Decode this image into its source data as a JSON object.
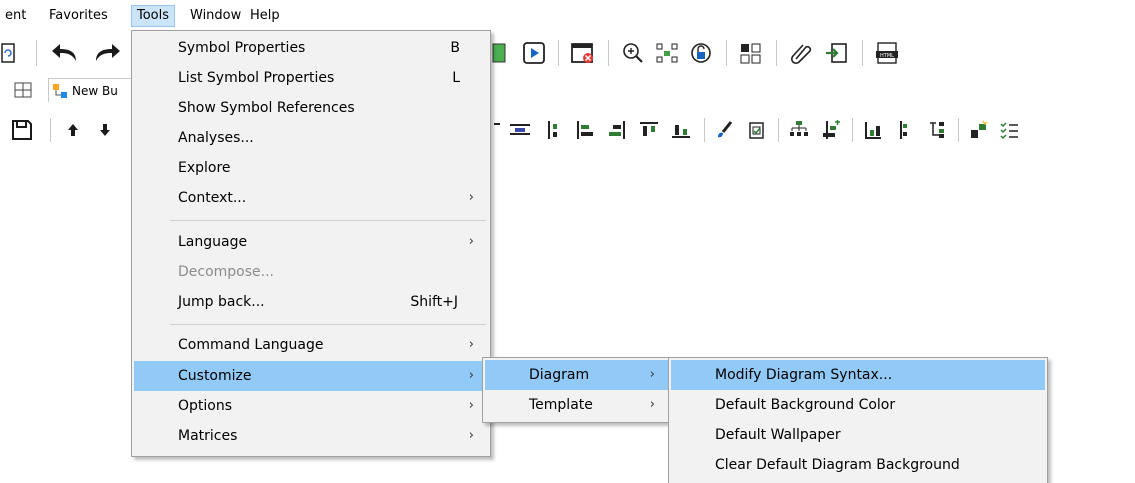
{
  "menubar": {
    "items": [
      {
        "label": "ent"
      },
      {
        "label": "Favorites"
      },
      {
        "label": "Tools"
      },
      {
        "label": "Window"
      },
      {
        "label": "Help"
      }
    ]
  },
  "tab": {
    "label": "New Bu"
  },
  "tools_menu": {
    "items": [
      {
        "label": "Symbol Properties",
        "shortcut": "B"
      },
      {
        "label": "List Symbol Properties",
        "shortcut": "L"
      },
      {
        "label": "Show Symbol References"
      },
      {
        "label": "Analyses..."
      },
      {
        "label": "Explore"
      },
      {
        "label": "Context...",
        "arrow": "›"
      },
      {
        "label": "Language",
        "arrow": "›"
      },
      {
        "label": "Decompose..."
      },
      {
        "label": "Jump back...",
        "shortcut": "Shift+J"
      },
      {
        "label": "Command Language",
        "arrow": "›"
      },
      {
        "label": "Customize",
        "arrow": "›"
      },
      {
        "label": "Options",
        "arrow": "›"
      },
      {
        "label": "Matrices",
        "arrow": "›"
      }
    ]
  },
  "customize_menu": {
    "items": [
      {
        "label": "Diagram",
        "arrow": "›"
      },
      {
        "label": "Template",
        "arrow": "›"
      }
    ]
  },
  "diagram_menu": {
    "items": [
      {
        "label": "Modify Diagram Syntax..."
      },
      {
        "label": "Default Background Color"
      },
      {
        "label": "Default Wallpaper"
      },
      {
        "label": "Clear Default Diagram Background"
      }
    ]
  },
  "colors": {
    "highlight": "#91c9f7",
    "menu_bg": "#f2f2f2",
    "menubar_active": "#cce4f7"
  }
}
